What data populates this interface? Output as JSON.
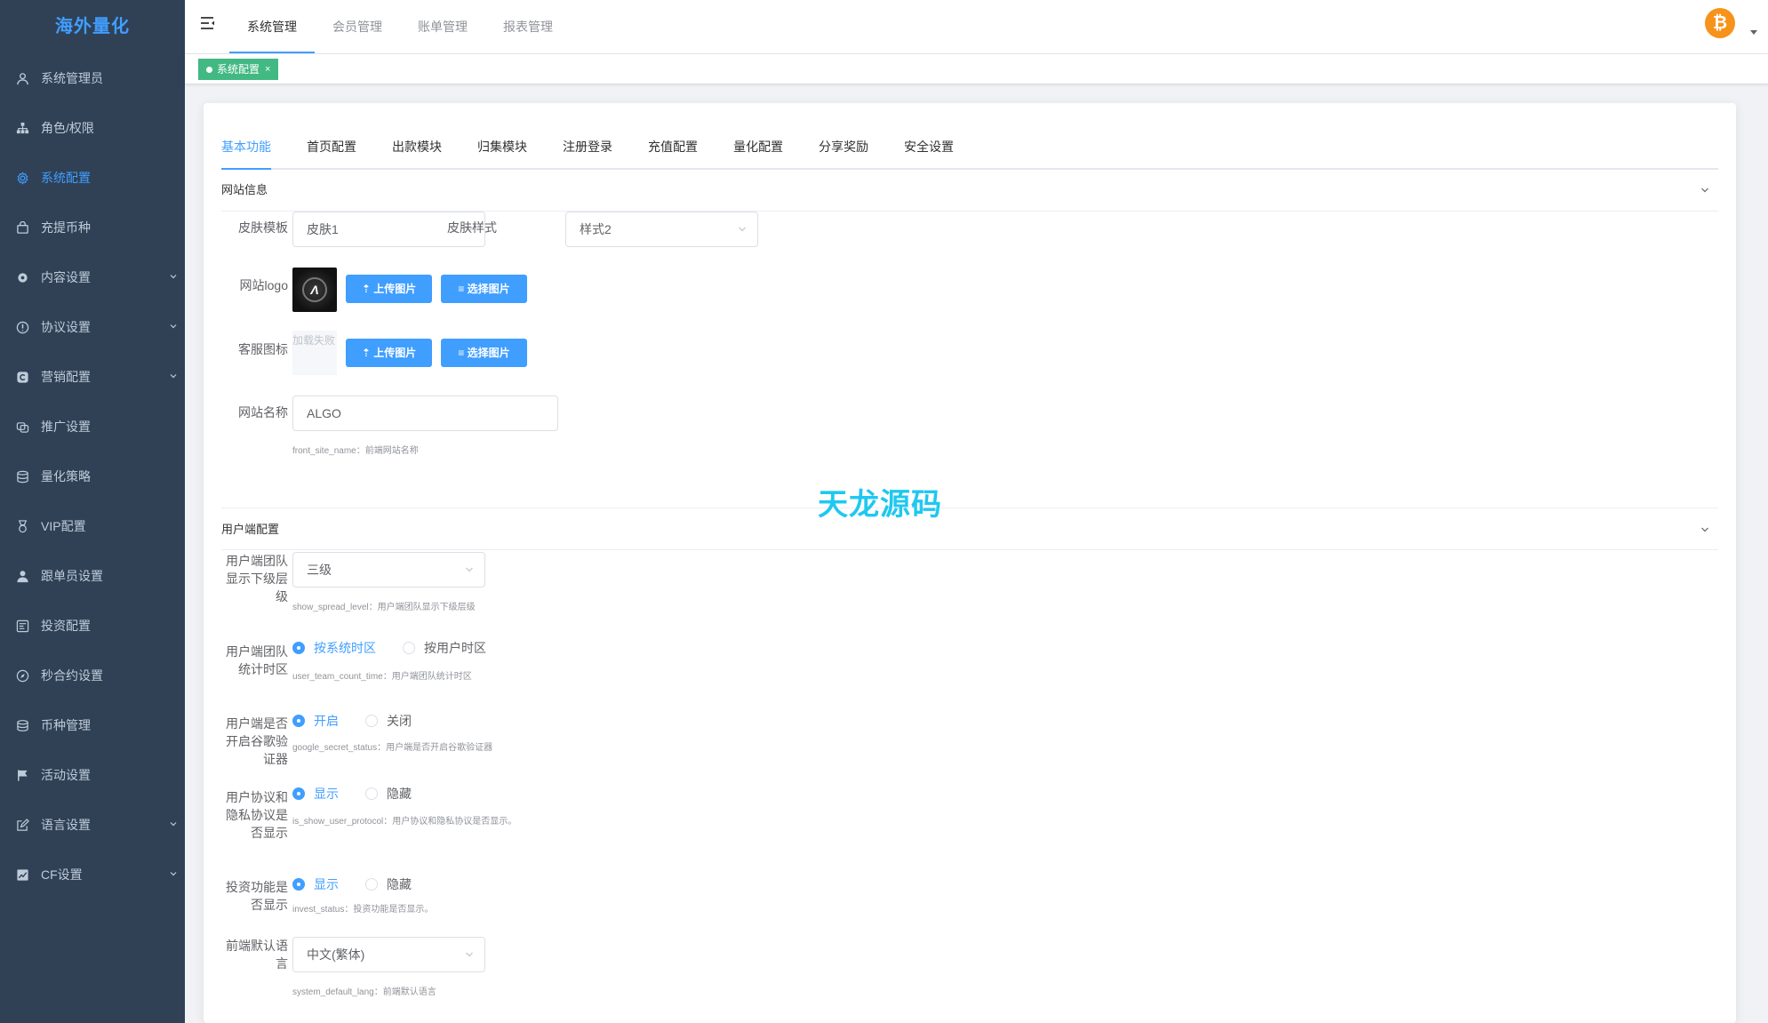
{
  "sidebar": {
    "logo": "海外量化",
    "items": [
      {
        "label": "系统管理员",
        "icon": "user-icon",
        "active": false,
        "has_children": false
      },
      {
        "label": "角色/权限",
        "icon": "org-tree-icon",
        "active": false,
        "has_children": false
      },
      {
        "label": "系统配置",
        "icon": "gear-icon",
        "active": true,
        "has_children": false
      },
      {
        "label": "充提币种",
        "icon": "bag-icon",
        "active": false,
        "has_children": false
      },
      {
        "label": "内容设置",
        "icon": "cog-icon",
        "active": false,
        "has_children": true
      },
      {
        "label": "协议设置",
        "icon": "info-circle-icon",
        "active": false,
        "has_children": true
      },
      {
        "label": "营销配置",
        "icon": "marketing-icon",
        "active": false,
        "has_children": true
      },
      {
        "label": "推广设置",
        "icon": "share-icon",
        "active": false,
        "has_children": false
      },
      {
        "label": "量化策略",
        "icon": "database-icon",
        "active": false,
        "has_children": false
      },
      {
        "label": "VIP配置",
        "icon": "medal-icon",
        "active": false,
        "has_children": false
      },
      {
        "label": "跟单员设置",
        "icon": "person-icon",
        "active": false,
        "has_children": false
      },
      {
        "label": "投资配置",
        "icon": "invest-icon",
        "active": false,
        "has_children": false
      },
      {
        "label": "秒合约设置",
        "icon": "compass-icon",
        "active": false,
        "has_children": false
      },
      {
        "label": "币种管理",
        "icon": "coins-icon",
        "active": false,
        "has_children": false
      },
      {
        "label": "活动设置",
        "icon": "flag-icon",
        "active": false,
        "has_children": false
      },
      {
        "label": "语言设置",
        "icon": "edit-icon",
        "active": false,
        "has_children": true
      },
      {
        "label": "CF设置",
        "icon": "chart-icon",
        "active": false,
        "has_children": true
      }
    ]
  },
  "navbar": {
    "tabs": [
      "系统管理",
      "会员管理",
      "账单管理",
      "报表管理"
    ],
    "active_tab": "系统管理",
    "avatar_glyph": "₿"
  },
  "tagsview": {
    "tag_label": "系统配置",
    "close_glyph": "×"
  },
  "config_tabs": [
    "基本功能",
    "首页配置",
    "出款模块",
    "归集模块",
    "注册登录",
    "充值配置",
    "量化配置",
    "分享奖励",
    "安全设置"
  ],
  "site_info": {
    "title": "网站信息",
    "skin_template_label": "皮肤模板",
    "skin_template_value": "皮肤1",
    "skin_style_label": "皮肤样式",
    "skin_style_value": "样式2",
    "logo_label": "网站logo",
    "logo_glyph": "Λ",
    "upload_button": "上传图片",
    "select_button": "选择图片",
    "service_icon_label": "客服图标",
    "service_icon_broken_text": "加载失败",
    "site_name_label": "网站名称",
    "site_name_value": "ALGO",
    "site_name_hint": "front_site_name：前端网站名称"
  },
  "watermark": "天龙源码",
  "user_config": {
    "title": "用户端配置",
    "team_level_label": "用户端团队显示下级层级",
    "team_level_value": "三级",
    "team_level_hint": "show_spread_level：用户端团队显示下级层级",
    "team_time_label": "用户端团队统计时区",
    "team_time_options": [
      "按系统时区",
      "按用户时区"
    ],
    "team_time_selected": 0,
    "team_time_hint": "user_team_count_time：用户端团队统计时区",
    "google_label": "用户端是否开启谷歌验证器",
    "google_options": [
      "开启",
      "关闭"
    ],
    "google_selected": 0,
    "google_hint": "google_secret_status：用户端是否开启谷歌验证器",
    "protocol_label": "用户协议和隐私协议是否显示",
    "protocol_options": [
      "显示",
      "隐藏"
    ],
    "protocol_selected": 0,
    "protocol_hint": "is_show_user_protocol：用户协议和隐私协议是否显示。",
    "invest_label": "投资功能是否显示",
    "invest_options": [
      "显示",
      "隐藏"
    ],
    "invest_selected": 0,
    "invest_hint": "invest_status：投资功能是否显示。",
    "lang_label": "前端默认语言",
    "lang_value": "中文(繁体)",
    "lang_hint": "system_default_lang：前端默认语言"
  },
  "colors": {
    "sidebar_bg": "#304156",
    "accent": "#409eff",
    "tag_green": "#42b983",
    "watermark": "#1fc8f0"
  }
}
